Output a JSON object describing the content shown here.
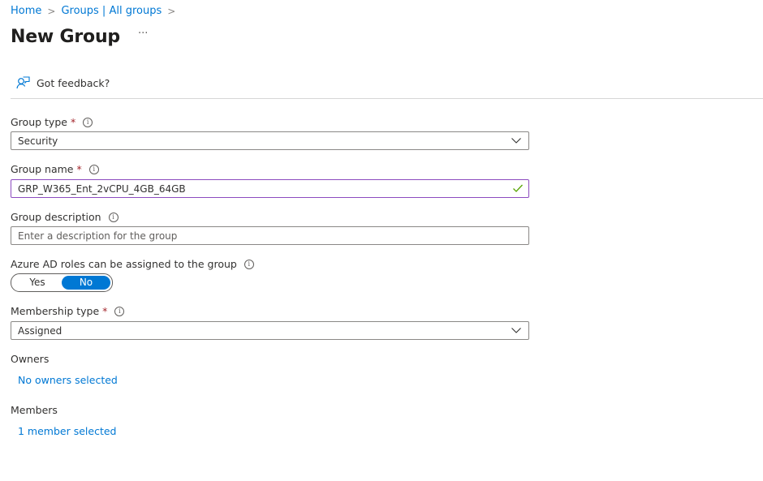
{
  "breadcrumb": {
    "items": [
      "Home",
      "Groups | All groups"
    ],
    "separator": ">"
  },
  "page": {
    "title": "New Group",
    "more_label": "···"
  },
  "feedback": {
    "label": "Got feedback?",
    "icon": "feedback-person-icon"
  },
  "form": {
    "group_type": {
      "label": "Group type",
      "required": "*",
      "value": "Security",
      "info_icon": "i"
    },
    "group_name": {
      "label": "Group name",
      "required": "*",
      "value": "GRP_W365_Ent_2vCPU_4GB_64GB",
      "info_icon": "i",
      "valid": true
    },
    "group_description": {
      "label": "Group description",
      "placeholder": "Enter a description for the group",
      "value": "",
      "info_icon": "i"
    },
    "azure_ad_roles": {
      "label": "Azure AD roles can be assigned to the group",
      "info_icon": "i",
      "options": [
        "Yes",
        "No"
      ],
      "selected": "No"
    },
    "membership_type": {
      "label": "Membership type",
      "required": "*",
      "value": "Assigned",
      "info_icon": "i"
    },
    "owners": {
      "label": "Owners",
      "link": "No owners selected"
    },
    "members": {
      "label": "Members",
      "link": "1 member selected"
    }
  },
  "colors": {
    "accent": "#0078d4",
    "required": "#a4262c",
    "valid_border": "#8c4bbf",
    "valid_check": "#57a300"
  }
}
